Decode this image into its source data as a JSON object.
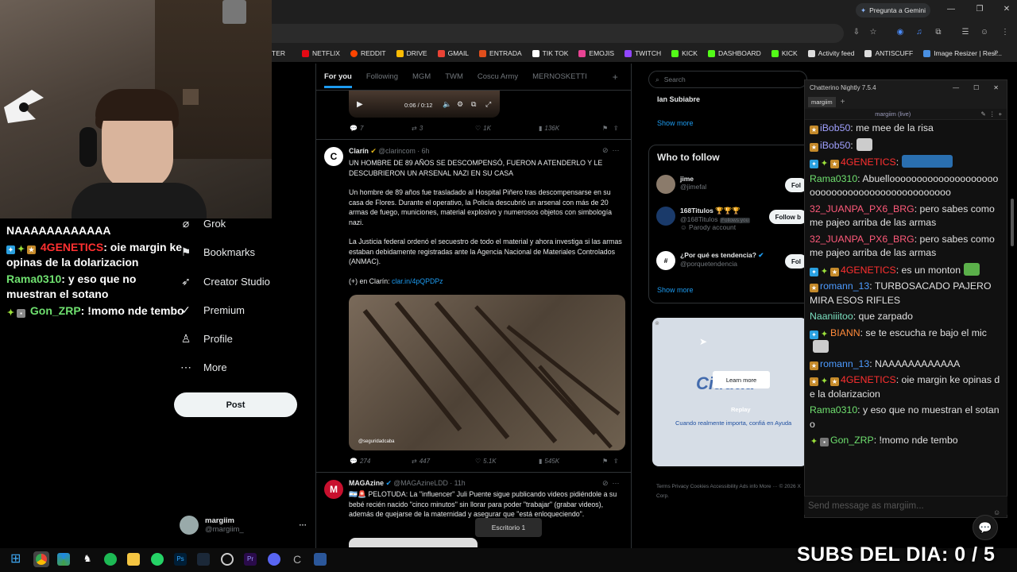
{
  "browser": {
    "gemini_label": "Pregunta a Gemini",
    "bookmarks_cut": "TER",
    "bookmarks": [
      {
        "label": "NETFLIX",
        "color": "#e50914"
      },
      {
        "label": "REDDIT",
        "color": "#ff4500"
      },
      {
        "label": "DRIVE",
        "color": "#fbbc04"
      },
      {
        "label": "GMAIL",
        "color": "#ea4335"
      },
      {
        "label": "ENTRADA",
        "color": "#e04e1c"
      },
      {
        "label": "TIK TOK",
        "color": "#ffffff"
      },
      {
        "label": "EMOJIS",
        "color": "#e84393"
      },
      {
        "label": "TWITCH",
        "color": "#9146ff"
      },
      {
        "label": "KICK",
        "color": "#53fc18"
      },
      {
        "label": "DASHBOARD",
        "color": "#53fc18"
      },
      {
        "label": "KICK",
        "color": "#53fc18"
      },
      {
        "label": "Activity feed",
        "color": "#dddddd"
      },
      {
        "label": "ANTISCUFF",
        "color": "#dddddd"
      },
      {
        "label": "Image Resizer | Resi...",
        "color": "#4a90e2"
      }
    ]
  },
  "stream_chat": {
    "line0": "NAAAAAAAAAAAA",
    "m1_user": "4GENETICS",
    "m1_text": ": oie margin ke opinas de la dolarizacion",
    "m2_user": "Rama0310",
    "m2_text": ": y eso que no muestran el sotano",
    "m3_user": "Gon_ZRP",
    "m3_text": ": !momo nde tembo"
  },
  "nav": {
    "grok": "Grok",
    "bookmarks": "Bookmarks",
    "creator": "Creator Studio",
    "premium": "Premium",
    "profile": "Profile",
    "more": "More",
    "post": "Post",
    "account_name": "margiim",
    "account_handle": "@margiim_",
    "account_more": "···"
  },
  "timeline": {
    "tabs": [
      "For you",
      "Following",
      "MGM",
      "TWM",
      "Coscu Army",
      "MERNOSKETTI",
      "+"
    ],
    "video_time": "0:06 / 0:12",
    "t0_actions": {
      "replies": "7",
      "reposts": "3",
      "likes": "1K",
      "views": "136K"
    },
    "t1": {
      "name": "Clarín",
      "handle": "@clarincom · 6h",
      "headline": "UN HOMBRE DE 89 AÑOS SE DESCOMPENSÓ, FUERON A ATENDERLO Y LE DESCUBRIERON UN ARSENAL NAZI EN SU CASA",
      "p1": "Un hombre de 89 años fue trasladado al Hospital Piñero tras descompensarse en su casa de Flores. Durante el operativo, la Policía descubrió un arsenal con más de 20 armas de fuego, municiones, material explosivo y numerosos objetos con simbología nazi.",
      "p2": "La Justicia federal ordenó el secuestro de todo el material y ahora investiga si las armas estaban debidamente registradas ante la Agencia Nacional de Materiales Controlados (ANMAC).",
      "p3_prefix": "(+) en Clarín: ",
      "p3_link": "clar.in/4pQPDPz",
      "image_credit": "@seguridadcaba",
      "actions": {
        "replies": "274",
        "reposts": "447",
        "likes": "5.1K",
        "views": "545K"
      }
    },
    "t2": {
      "name": "MAGAzine",
      "handle": "@MAGAzineLDD · 11h",
      "text": "PELOTUDA: La \"influencer\" Juli Puente sigue publicando videos pidiéndole a su bebé recién nacido \"cinco minutos\" sin llorar para poder \"trabajar\" (grabar videos), además de quejarse de la maternidad y asegurar que \"está enloqueciendo\"."
    }
  },
  "right": {
    "search_placeholder": "Search",
    "trend_name": "Ian Subiabre",
    "show_more": "Show more",
    "who_to_follow": "Who to follow",
    "w1_name": "jime",
    "w1_handle": "@jimefal",
    "w2_name": "168Titulos 🏆🏆🏆",
    "w2_handle": "@168Titulos",
    "w2_follows": "Follows you",
    "w2_sub": "Parody account",
    "w3_name": "¿Por qué es tendencia?",
    "w3_handle": "@porquetendencia",
    "follow": "Fol",
    "follow_b": "Follow b",
    "show_more2": "Show more",
    "ad_brand": "Ciudad",
    "ad_learn": "Learn more",
    "ad_replay": "Replay",
    "ad_caption": "Cuando realmente importa, confiá en Ayuda",
    "footer": "Terms  Privacy  Cookies  Accessibility  Ads info  More ···  © 2026 X Corp."
  },
  "chatterino": {
    "title": "Chatterino Nightly 7.5.4",
    "tab": "margiim",
    "split": "margiim (live)",
    "messages": [
      {
        "user": "iBob50",
        "color": "#a1a1ff",
        "text": ": me mee de la risa"
      },
      {
        "user": "iBob50",
        "color": "#a1a1ff",
        "text": ":"
      },
      {
        "user": "4GENETICS",
        "color": "#ff3030",
        "text": ":"
      },
      {
        "user": "Rama0310",
        "color": "#6fe06f",
        "text": ": Abuelloooooooooooooooooooooooooooooooooooooooooooooo"
      },
      {
        "user": "32_JUANPA_PX6_BRG",
        "color": "#ff5a7a",
        "text": ": pero sabes como me pajeo arriba de las armas"
      },
      {
        "user": "32_JUANPA_PX6_BRG",
        "color": "#ff5a7a",
        "text": ": pero sabes como me pajeo arriba de las armas"
      },
      {
        "user": "4GENETICS",
        "color": "#ff3030",
        "text": ": es un monton"
      },
      {
        "user": "romann_13",
        "color": "#4d9bff",
        "text": ": TURBOSACADO PAJERO MIRA ESOS RIFLES"
      },
      {
        "user": "Naaniiitoo",
        "color": "#7be0c0",
        "text": ": que zarpado"
      },
      {
        "user": "BIANN",
        "color": "#ff8a3a",
        "text": ": se te escucha re bajo el mic"
      },
      {
        "user": "romann_13",
        "color": "#4d9bff",
        "text": ": NAAAAAAAAAAAA"
      },
      {
        "user": "4GENETICS",
        "color": "#ff3030",
        "text": ": oie margin ke opinas de la dolarizacion"
      },
      {
        "user": "Rama0310",
        "color": "#6fe06f",
        "text": ": y eso que no muestran el sotano"
      },
      {
        "user": "Gon_ZRP",
        "color": "#6fe06f",
        "text": ": !momo nde tembo"
      }
    ],
    "input_placeholder": "Send message as margiim..."
  },
  "overlay": {
    "subs": "SUBS DEL DIA: 0 / 5",
    "desktop": "Escritorio 1"
  }
}
